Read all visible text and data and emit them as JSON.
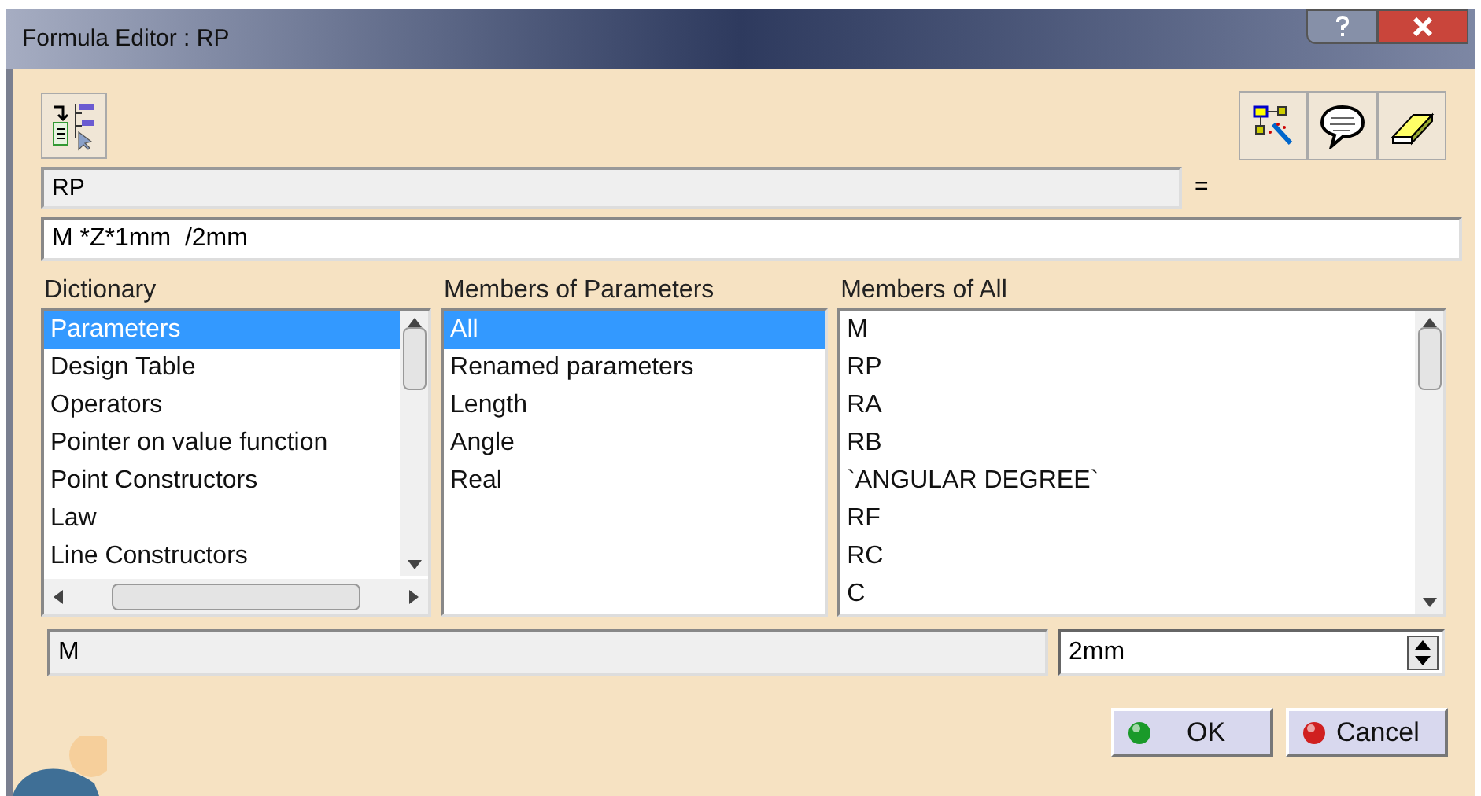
{
  "window": {
    "title": "Formula Editor : RP"
  },
  "parameter_field": {
    "value": "RP"
  },
  "equals": "=",
  "formula_field": {
    "value": "M *Z*1mm  /2mm"
  },
  "lists": [
    {
      "label": "Dictionary",
      "items": [
        {
          "text": "Parameters",
          "selected": true
        },
        {
          "text": "Design Table",
          "selected": false
        },
        {
          "text": "Operators",
          "selected": false
        },
        {
          "text": "Pointer on value function",
          "selected": false
        },
        {
          "text": "Point Constructors",
          "selected": false
        },
        {
          "text": "Law",
          "selected": false
        },
        {
          "text": "Line Constructors",
          "selected": false
        }
      ],
      "kind": "twoway"
    },
    {
      "label": "Members of Parameters",
      "items": [
        {
          "text": "All",
          "selected": true
        },
        {
          "text": "Renamed parameters",
          "selected": false
        },
        {
          "text": "Length",
          "selected": false
        },
        {
          "text": "Angle",
          "selected": false
        },
        {
          "text": "Real",
          "selected": false
        }
      ],
      "kind": "plain"
    },
    {
      "label": "Members of All",
      "items": [
        {
          "text": "M",
          "selected": false
        },
        {
          "text": "RP",
          "selected": false
        },
        {
          "text": "RA",
          "selected": false
        },
        {
          "text": "RB",
          "selected": false
        },
        {
          "text": "`ANGULAR DEGREE`",
          "selected": false
        },
        {
          "text": "RF",
          "selected": false
        },
        {
          "text": "RC",
          "selected": false
        },
        {
          "text": "C",
          "selected": false
        }
      ],
      "kind": "vertical"
    }
  ],
  "selected_member_field": {
    "value": "M"
  },
  "value_spinner": {
    "value": "2mm"
  },
  "buttons": [
    {
      "label": "OK",
      "kind": "ok"
    },
    {
      "label": "Cancel",
      "kind": "cancel"
    }
  ]
}
